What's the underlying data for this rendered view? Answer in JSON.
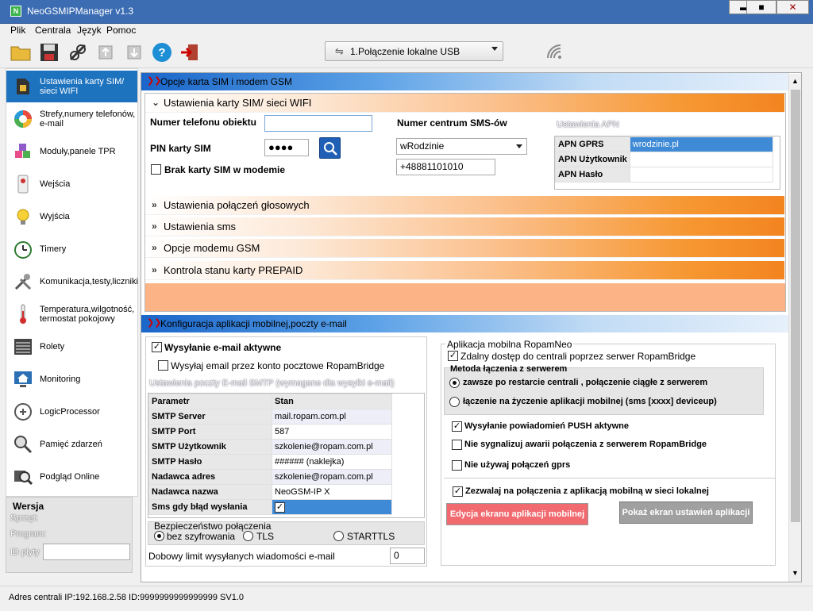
{
  "window": {
    "title": "NeoGSMIPManager v1.3",
    "minimize": "▬",
    "maximize": "■",
    "close": "✕"
  },
  "menu": [
    "Plik",
    "Centrala",
    "Język",
    "Pomoc"
  ],
  "connection": {
    "selected": "1.Połączenie lokalne USB"
  },
  "sidebar": {
    "items": [
      {
        "label": "Ustawienia karty SIM/ sieci WIFI"
      },
      {
        "label": "Strefy,numery telefonów, e-mail"
      },
      {
        "label": "Moduły,panele TPR"
      },
      {
        "label": "Wejścia"
      },
      {
        "label": "Wyjścia"
      },
      {
        "label": "Timery"
      },
      {
        "label": "Komunikacja,testy,liczniki"
      },
      {
        "label": "Temperatura,wilgotność, termostat pokojowy"
      },
      {
        "label": "Rolety"
      },
      {
        "label": "Monitoring"
      },
      {
        "label": "LogicProcessor"
      },
      {
        "label": "Pamięć zdarzeń"
      },
      {
        "label": "Podgląd Online"
      }
    ]
  },
  "version": {
    "heading": "Wersja",
    "hw": "Sprzęt:",
    "program": "Program:",
    "id": "ID płyty",
    "id_value": ""
  },
  "sim_section": {
    "header": "Opcje karta SIM i modem GSM",
    "sub": "Ustawienia karty SIM/ sieci WIFI",
    "phone_label": "Numer telefonu obiektu",
    "phone_value": "",
    "pin_label": "PIN karty SIM",
    "pin_value": "●●●●",
    "no_sim_label": "Brak karty SIM w modemie",
    "sms_center_label": "Numer centrum SMS-ów",
    "operator": "wRodzinie",
    "sms_number": "+48881101010",
    "apn_title": "Ustawienia APN",
    "apn": [
      {
        "k": "APN GPRS",
        "v": "wrodzinie.pl"
      },
      {
        "k": "APN Użytkownik",
        "v": ""
      },
      {
        "k": "APN Hasło",
        "v": ""
      }
    ],
    "collapsed": [
      "Ustawienia połączeń głosowych",
      "Ustawienia sms",
      "Opcje modemu GSM",
      "Kontrola stanu karty PREPAID"
    ]
  },
  "mobile_section": {
    "header": "Konfiguracja aplikacji mobilnej,poczty e-mail",
    "email_active": "Wysyłanie e-mail aktywne",
    "send_via_bridge": "Wysyłaj email przez konto pocztowe RopamBridge",
    "smtp_title": "Ustawienia poczty E-mail SMTP (wymagane dla wysyłki e-mail)",
    "smtp_cols": [
      "Parametr",
      "Stan"
    ],
    "smtp_rows": [
      {
        "k": "SMTP Server",
        "v": "mail.ropam.com.pl"
      },
      {
        "k": "SMTP Port",
        "v": "587"
      },
      {
        "k": "SMTP Użytkownik",
        "v": "szkolenie@ropam.com.pl"
      },
      {
        "k": "SMTP Hasło",
        "v": "###### (naklejka)"
      },
      {
        "k": "Nadawca adres",
        "v": "szkolenie@ropam.com.pl"
      },
      {
        "k": "Nadawca nazwa",
        "v": "NeoGSM-IP X"
      },
      {
        "k": "Sms gdy błąd wysłania",
        "v": "✓"
      }
    ],
    "security_title": "Bezpieczeństwo połączenia",
    "security": [
      "bez szyfrowania",
      "TLS",
      "STARTTLS"
    ],
    "daily_limit_label": "Dobowy limit wysyłanych wiadomości e-mail",
    "daily_limit": "0",
    "app_title": "Aplikacja mobilna RopamNeo",
    "remote_access": "Zdalny dostęp do centrali poprzez serwer RopamBridge",
    "method_title": "Metoda łączenia z serwerem",
    "method1": "zawsze po restarcie centrali , połączenie ciągłe z serwerem",
    "method2": "łączenie na życzenie aplikacji mobilnej  (sms [xxxx] deviceup)",
    "push": "Wysyłanie powiadomień PUSH aktywne",
    "no_alarm": "Nie sygnalizuj awarii  połączenia z serwerem RopamBridge",
    "no_gprs": "Nie używaj połączeń gprs",
    "local": "Zezwalaj na połączenia z aplikacją mobilną w sieci lokalnej",
    "edit_btn": "Edycja ekranu aplikacji mobilnej",
    "show_btn": "Pokaż ekran ustawień aplikacji"
  },
  "status": "Adres centrali IP:192.168.2.58 ID:9999999999999999 SV1.0"
}
